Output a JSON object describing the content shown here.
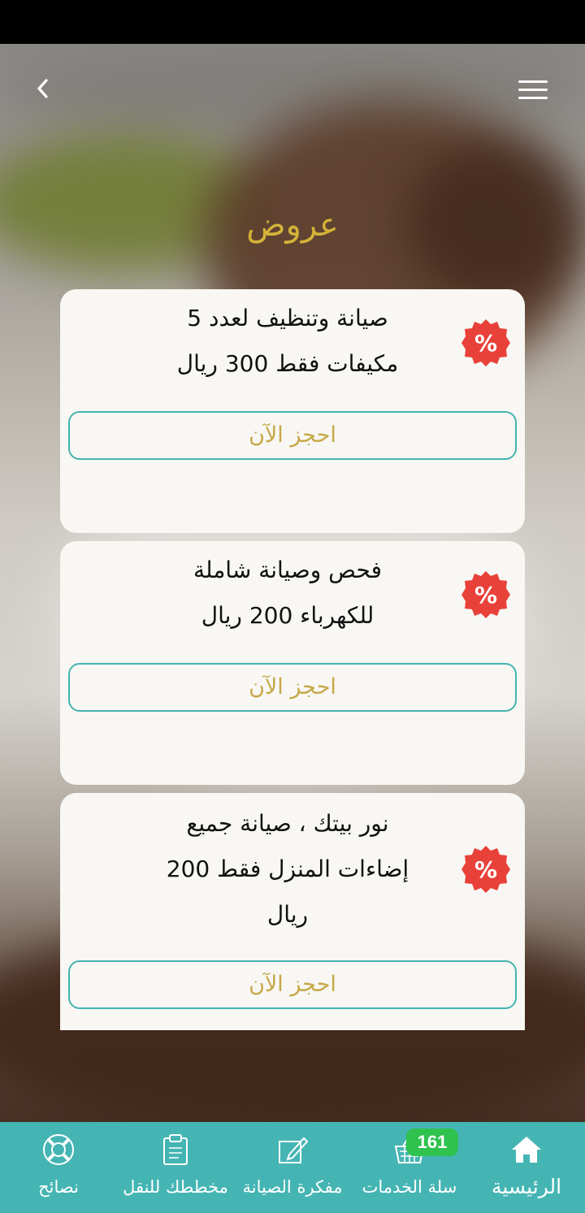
{
  "page": {
    "title": "عروض"
  },
  "colors": {
    "accent": "#d4b339",
    "teal": "#45b5b3",
    "badge_red": "#e8413a",
    "cart_badge_green": "#2fc24f",
    "card_bg": "#f8f7f3"
  },
  "offers": [
    {
      "text": "صيانة وتنظيف لعدد 5\nمكيفات فقط 300 ريال",
      "icon": "discount-percent-icon",
      "button_label": "احجز الآن"
    },
    {
      "text": "فحص وصيانة شاملة\nللكهرباء 200 ريال",
      "icon": "discount-percent-icon",
      "button_label": "احجز الآن"
    },
    {
      "text": "نور بيتك ، صيانة جميع\nإضاءات المنزل فقط 200\nريال",
      "icon": "discount-percent-icon",
      "button_label": "احجز الآن"
    }
  ],
  "bottom_nav": {
    "items": [
      {
        "label": "الرئيسية",
        "icon": "home-icon",
        "active": true
      },
      {
        "label": "سلة الخدمات",
        "icon": "basket-icon",
        "badge": "161"
      },
      {
        "label": "مفكرة الصيانة",
        "icon": "edit-note-icon"
      },
      {
        "label": "مخططك للنقل",
        "icon": "clipboard-icon"
      },
      {
        "label": "نصائح",
        "icon": "lifebuoy-icon"
      }
    ]
  }
}
